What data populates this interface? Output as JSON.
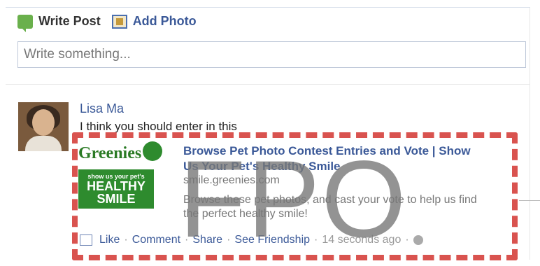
{
  "composer": {
    "write_post_label": "Write Post",
    "add_photo_label": "Add Photo",
    "input_placeholder": "Write something..."
  },
  "post": {
    "author_name": "Lisa Ma",
    "message": "I think you should enter in this",
    "share": {
      "logo_text": "Greenies",
      "logo_sub": "show us your pet's",
      "logo_big_line1": "HEALTHY",
      "logo_big_line2": "SMILE",
      "title": "Browse Pet Photo Contest Entries and Vote | Show Us Your Pet's Healthy Smile",
      "domain": "smile.greenies.com",
      "description": "Browse these pet photos, and cast your vote to help us find the perfect healthy smile!"
    },
    "actions": {
      "like": "Like",
      "comment": "Comment",
      "share": "Share",
      "see_friendship": "See Friendship",
      "timestamp": "14 seconds ago",
      "separator": "·"
    }
  },
  "overlay": {
    "fpo_text": "FPO",
    "dash_color": "#d9534f"
  },
  "colors": {
    "link": "#3b5998",
    "logo_green": "#2e8b2e"
  }
}
